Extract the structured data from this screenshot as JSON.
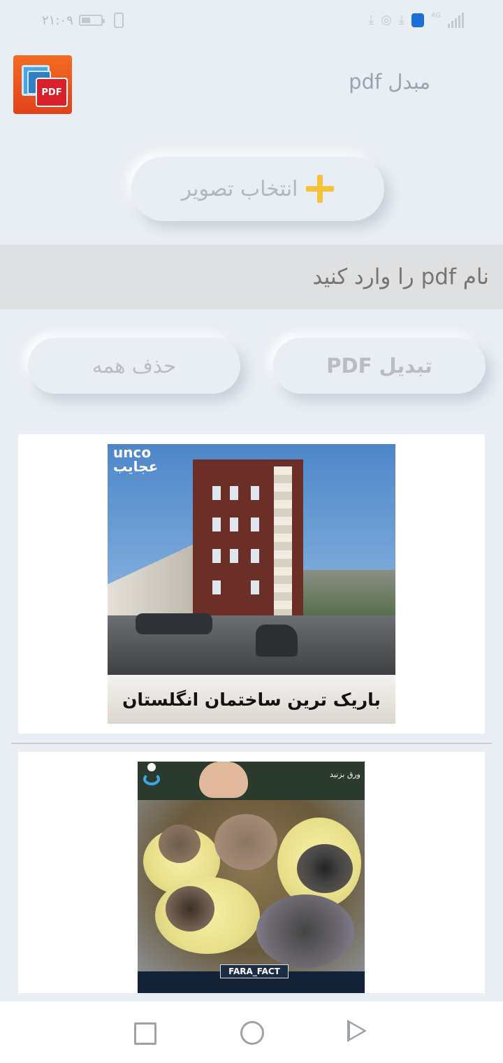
{
  "status_bar": {
    "time": "۲۱:۰۹",
    "network_type": "4G",
    "icons": [
      "battery-icon",
      "vibrate-icon",
      "download-icon",
      "whatsapp-icon",
      "download-icon",
      "shield-icon",
      "signal-icon"
    ]
  },
  "header": {
    "title": "مبدل pdf",
    "app_icon_label": "PDF"
  },
  "select_image_button": {
    "label": "انتخاب تصویر",
    "icon": "plus-icon"
  },
  "pdf_name": {
    "placeholder": "نام pdf را وارد کنید",
    "value": ""
  },
  "actions": {
    "convert_label": "تبدیل PDF",
    "delete_all_label": "حذف همه"
  },
  "images": [
    {
      "caption": "باریک ترین ساختمان انگلستان",
      "watermark": "unco\nعجایب"
    },
    {
      "tag": "FARA_FACT",
      "channel": "ورق بزنید"
    }
  ],
  "nav_bar": {
    "buttons": [
      "recents-icon",
      "home-icon",
      "back-icon"
    ]
  },
  "colors": {
    "background": "#e9eef4",
    "accent_plus": "#f4c23b",
    "app_icon": "#e1421a",
    "input_text": "#5a7487"
  }
}
